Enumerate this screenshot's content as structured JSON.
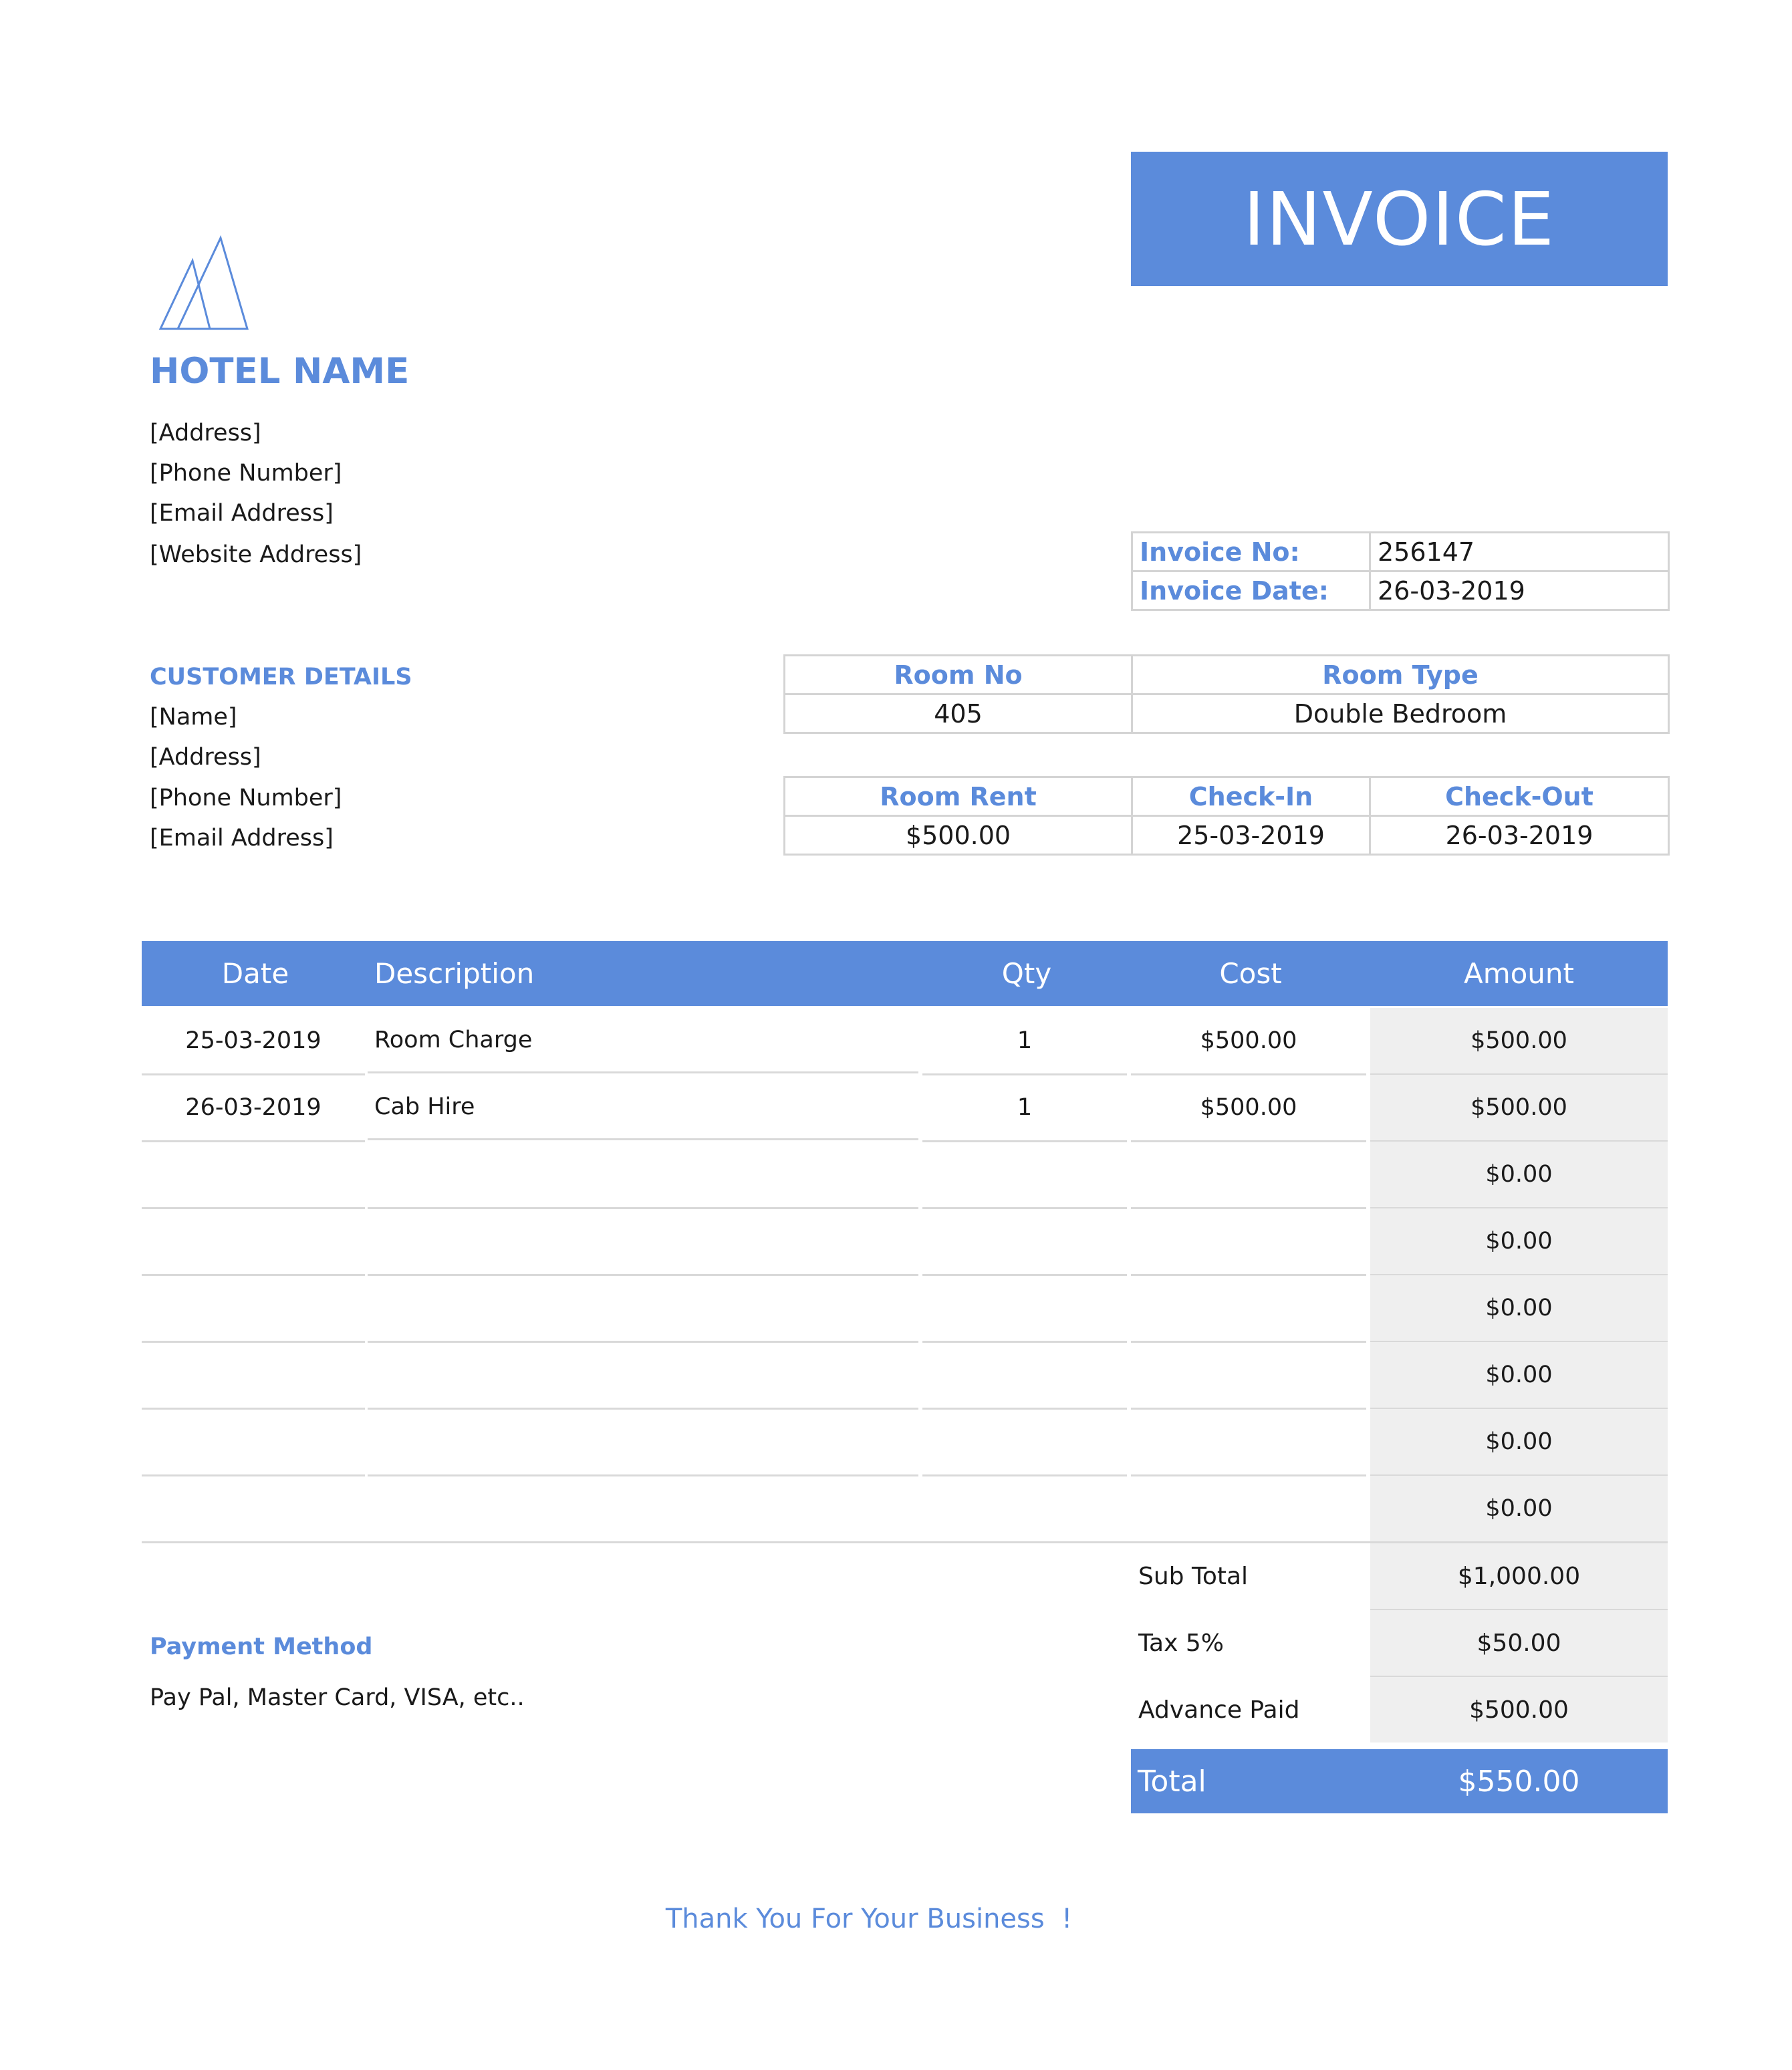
{
  "header": {
    "title": "INVOICE",
    "hotel_name": "HOTEL NAME"
  },
  "hotel": {
    "address": "[Address]",
    "phone": "[Phone Number]",
    "email": "[Email Address]",
    "website": "[Website Address]"
  },
  "invoice": {
    "no_label": "Invoice No:",
    "no_value": "256147",
    "date_label": "Invoice Date:",
    "date_value": "26-03-2019"
  },
  "customer": {
    "heading": "CUSTOMER DETAILS",
    "name": "[Name]",
    "address": "[Address]",
    "phone": "[Phone Number]",
    "email": "[Email Address]"
  },
  "room": {
    "no_label": "Room No",
    "no_value": "405",
    "type_label": "Room Type",
    "type_value": "Double Bedroom",
    "rent_label": "Room Rent",
    "rent_value": "$500.00",
    "checkin_label": "Check-In",
    "checkin_value": "25-03-2019",
    "checkout_label": "Check-Out",
    "checkout_value": "26-03-2019"
  },
  "items": {
    "headers": {
      "date": "Date",
      "description": "Description",
      "qty": "Qty",
      "cost": "Cost",
      "amount": "Amount"
    },
    "rows": [
      {
        "date": "25-03-2019",
        "description": "Room Charge",
        "qty": "1",
        "cost": "$500.00",
        "amount": "$500.00"
      },
      {
        "date": "26-03-2019",
        "description": "Cab Hire",
        "qty": "1",
        "cost": "$500.00",
        "amount": "$500.00"
      },
      {
        "date": "",
        "description": "",
        "qty": "",
        "cost": "",
        "amount": "$0.00"
      },
      {
        "date": "",
        "description": "",
        "qty": "",
        "cost": "",
        "amount": "$0.00"
      },
      {
        "date": "",
        "description": "",
        "qty": "",
        "cost": "",
        "amount": "$0.00"
      },
      {
        "date": "",
        "description": "",
        "qty": "",
        "cost": "",
        "amount": "$0.00"
      },
      {
        "date": "",
        "description": "",
        "qty": "",
        "cost": "",
        "amount": "$0.00"
      },
      {
        "date": "",
        "description": "",
        "qty": "",
        "cost": "",
        "amount": "$0.00"
      }
    ]
  },
  "summary": {
    "subtotal_label": "Sub Total",
    "subtotal_value": "$1,000.00",
    "tax_label": "Tax 5%",
    "tax_value": "$50.00",
    "advance_label": "Advance Paid",
    "advance_value": "$500.00",
    "total_label": "Total",
    "total_value": "$550.00"
  },
  "payment": {
    "heading": "Payment Method",
    "methods": "Pay Pal, Master Card, VISA, etc.."
  },
  "footer": {
    "thanks": "Thank You For Your Business  !"
  },
  "colors": {
    "accent": "#5b8bdb",
    "amount_bg": "#efefef",
    "border": "#d4d4d4"
  }
}
